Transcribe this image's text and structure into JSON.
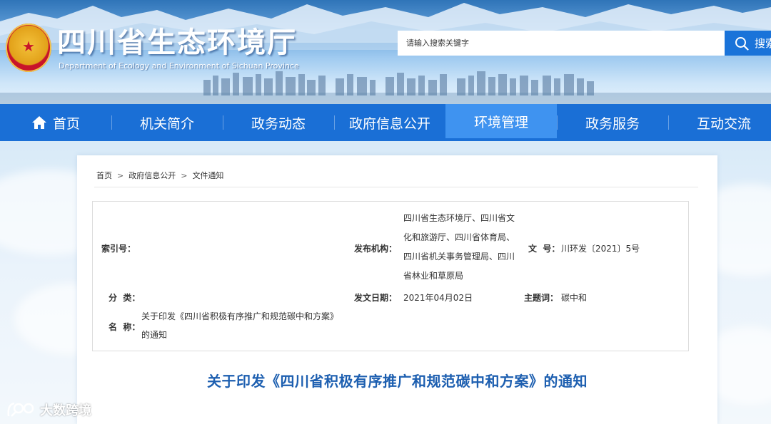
{
  "header": {
    "title": "四川省生态环境厅",
    "subtitle": "Department of Ecology and Environment of Sichuan Province",
    "emblem_icon": "national-emblem-icon"
  },
  "search": {
    "placeholder": "请输入搜索关键字",
    "button_label": "搜索",
    "icon": "search-icon"
  },
  "nav": {
    "items": [
      {
        "label": "首页",
        "icon": "home-icon"
      },
      {
        "label": "机关简介"
      },
      {
        "label": "政务动态"
      },
      {
        "label": "政府信息公开"
      },
      {
        "label": "环境管理",
        "active": true
      },
      {
        "label": "政务服务"
      },
      {
        "label": "互动交流"
      }
    ]
  },
  "breadcrumb": {
    "items": [
      "首页",
      "政府信息公开",
      "文件通知"
    ],
    "separator": ">"
  },
  "meta": {
    "index_label": "索引号：",
    "index_value": "",
    "publisher_label": "发布机构：",
    "publisher_value": "四川省生态环境厅、四川省文化和旅游厅、四川省体育局、四川省机关事务管理局、四川省林业和草原局",
    "docno_label": "文  号：",
    "docno_value": "川环发〔2021〕5号",
    "category_label": "分  类：",
    "category_value": "",
    "date_label": "发文日期：",
    "date_value": "2021年04月02日",
    "subject_label": "主题词：",
    "subject_value": "碳中和",
    "name_label": "名  称：",
    "name_value": "关于印发《四川省积极有序推广和规范碳中和方案》的通知"
  },
  "document_title": "关于印发《四川省积极有序推广和规范碳中和方案》的通知",
  "watermark": {
    "text": "大数跨境",
    "icon": "brand-logo-icon"
  },
  "colors": {
    "nav_bg": "#1a6fd6",
    "nav_active": "#3f93f0",
    "title_blue": "#1d5fb0",
    "search_button": "#1a73d9"
  }
}
